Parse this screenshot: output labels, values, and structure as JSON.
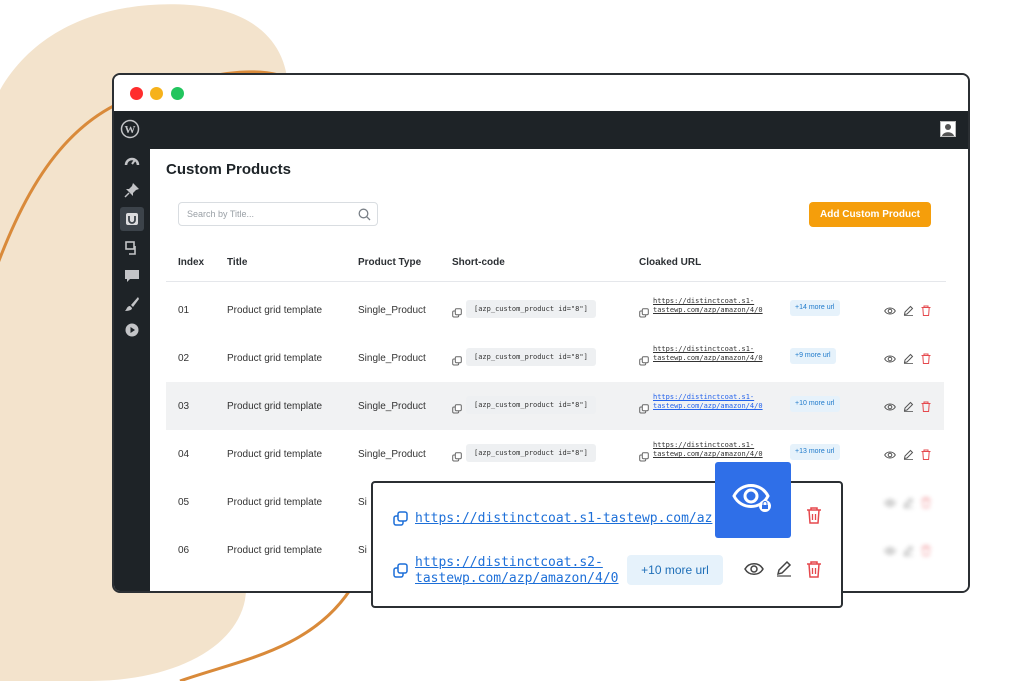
{
  "window": {
    "controls": [
      "close",
      "minimize",
      "maximize"
    ]
  },
  "admin_bar": {
    "logo": "wordpress-icon",
    "avatar": "user-avatar"
  },
  "sidebar": {
    "icons": [
      "dashboard-icon",
      "pin-icon",
      "plugin-icon",
      "media-icon",
      "comments-icon",
      "brush-icon",
      "play-icon"
    ],
    "active_index": 2
  },
  "page": {
    "title": "Custom Products",
    "search_placeholder": "Search by Title...",
    "add_button": "Add Custom Product"
  },
  "table": {
    "headers": [
      "Index",
      "Title",
      "Product Type",
      "Short-code",
      "Cloaked URL"
    ],
    "rows": [
      {
        "index": "01",
        "title": "Product grid template",
        "type": "Single_Product",
        "shortcode": "[azp_custom_product id=\"8\"]",
        "url": "https://distinctcoat.s1-\ntastewp.com/azp/amazon/4/0",
        "more": "+14 more url"
      },
      {
        "index": "02",
        "title": "Product grid template",
        "type": "Single_Product",
        "shortcode": "[azp_custom_product id=\"8\"]",
        "url": "https://distinctcoat.s1-\ntastewp.com/azp/amazon/4/0",
        "more": "+9 more url"
      },
      {
        "index": "03",
        "title": "Product grid template",
        "type": "Single_Product",
        "shortcode": "[azp_custom_product id=\"8\"]",
        "url": "https://distinctcoat.s1-\ntastewp.com/azp/amazon/4/0",
        "more": "+10 more url"
      },
      {
        "index": "04",
        "title": "Product grid template",
        "type": "Single_Product",
        "shortcode": "[azp_custom_product id=\"8\"]",
        "url": "https://distinctcoat.s1-\ntastewp.com/azp/amazon/4/0",
        "more": "+13 more url"
      },
      {
        "index": "05",
        "title": "Product grid template",
        "type": "Si"
      },
      {
        "index": "06",
        "title": "Product grid template",
        "type": "Si"
      }
    ],
    "highlighted_row": 2
  },
  "popup": {
    "url1": "https://distinctcoat.s1-tastewp.com/az",
    "url2": "https://distinctcoat.s2-\ntastewp.com/azp/amazon/4/0",
    "more": "+10 more url"
  },
  "colors": {
    "accent": "#f59e0b",
    "link": "#2563eb",
    "admin_dark": "#1e2327",
    "delete": "#e5484d",
    "eye_tile": "#2f6fe8",
    "blob_fill": "#f3e3cc",
    "blob_stroke": "#d98a3a"
  }
}
